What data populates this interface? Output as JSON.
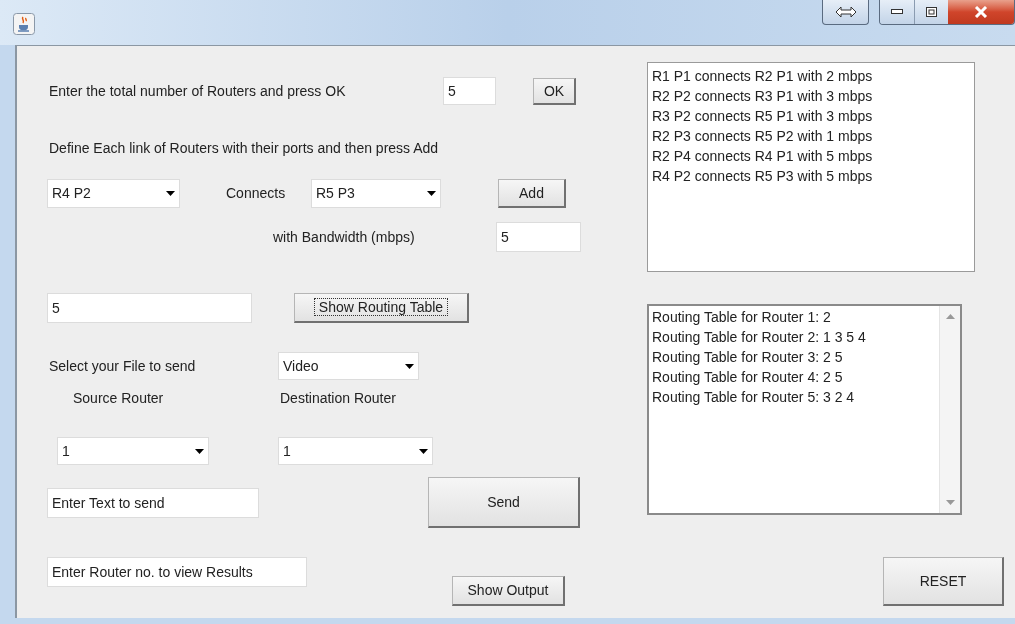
{
  "router_count": {
    "label": "Enter the total number of Routers and press OK",
    "value": "5",
    "button": "OK"
  },
  "link": {
    "instruction": "Define Each link of Routers with their ports and then press Add",
    "from": "R4 P2",
    "connects_label": "Connects",
    "to": "R5 P3",
    "add_button": "Add",
    "bandwidth_label": "with Bandwidth (mbps)",
    "bandwidth_value": "5"
  },
  "routing": {
    "value": "5",
    "button": "Show Routing Table",
    "focused": true
  },
  "file": {
    "label": "Select your File to send",
    "value": "Video"
  },
  "source": {
    "label": "Source Router",
    "value": "1"
  },
  "destination": {
    "label": "Destination Router",
    "value": "1"
  },
  "text_field": {
    "value": "Enter Text to send"
  },
  "send_button": "Send",
  "result_field": {
    "value": "Enter Router no. to view Results"
  },
  "show_output_button": "Show Output",
  "links": [
    "R1 P1 connects R2 P1 with 2 mbps",
    "R2 P2 connects R3 P1 with 3 mbps",
    "R3 P2 connects R5 P1 with 3 mbps",
    "R2 P3 connects R5 P2 with 1 mbps",
    "R2 P4 connects R4 P1 with 5 mbps",
    "R4 P2 connects R5 P3 with 5 mbps"
  ],
  "routing_table": [
    "Routing Table for Router 1: 2",
    "Routing Table for Router 2: 1 3 5 4",
    "Routing Table for Router 3: 2 5",
    "Routing Table for Router 4: 2 5",
    "Routing Table for Router 5: 3 2 4"
  ],
  "reset_button": "RESET"
}
